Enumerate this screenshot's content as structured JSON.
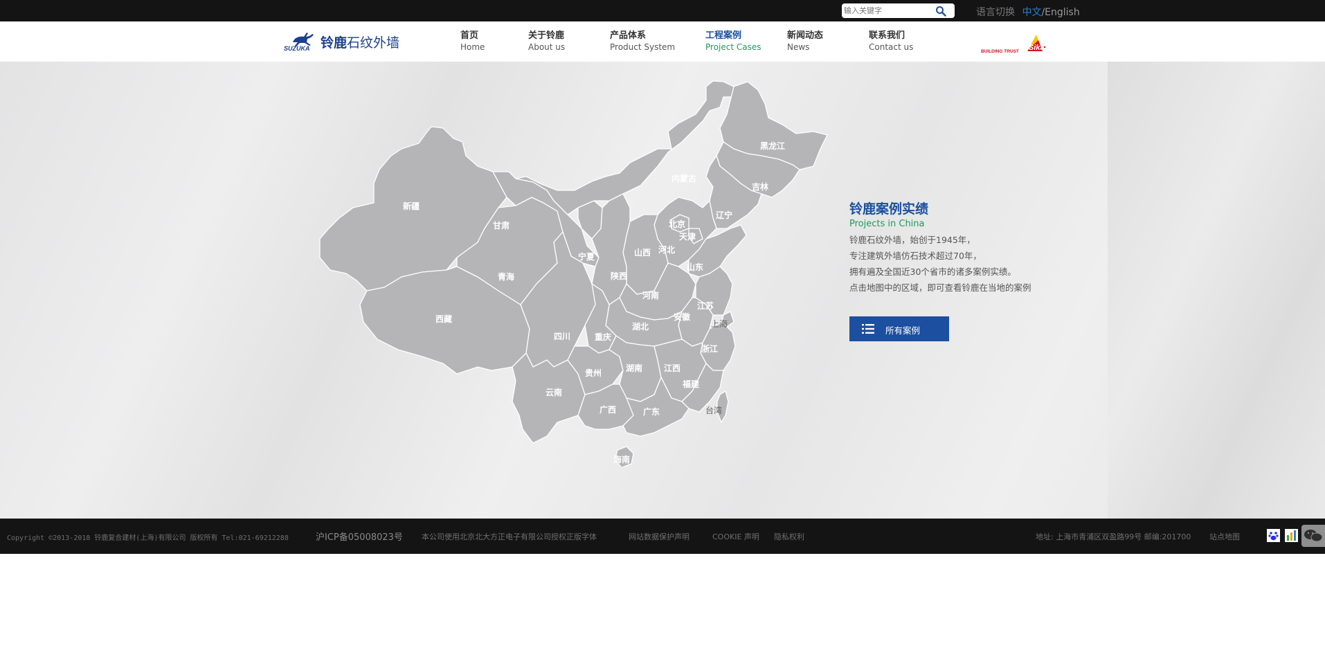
{
  "topbar": {
    "search_placeholder": "输入关键字",
    "lang_label": "语言切换",
    "lang_zh": "中文",
    "lang_sep": "/",
    "lang_en": "English"
  },
  "header": {
    "logo_text_bold": "铃鹿",
    "logo_text": "石纹外墙",
    "logo_mark_text": "SUZUKA",
    "nav": [
      {
        "cn": "首页",
        "en": "Home",
        "active": false
      },
      {
        "cn": "关于铃鹿",
        "en": "About us",
        "active": false
      },
      {
        "cn": "产品体系",
        "en": "Product System",
        "active": false
      },
      {
        "cn": "工程案例",
        "en": "Project Cases",
        "active": true
      },
      {
        "cn": "新闻动态",
        "en": "News",
        "active": false
      },
      {
        "cn": "联系我们",
        "en": "Contact us",
        "active": false
      }
    ],
    "partner_slogan": "BUILDING TRUST",
    "partner_name": "Sika"
  },
  "map": {
    "provinces": {
      "xinjiang": "新疆",
      "xizang": "西藏",
      "qinghai": "青海",
      "gansu": "甘肃",
      "neimenggu": "内蒙古",
      "heilongjiang": "黑龙江",
      "jilin": "吉林",
      "liaoning": "辽宁",
      "beijing": "北京",
      "tianjin": "天津",
      "hebei": "河北",
      "shanxi": "山西",
      "shandong": "山东",
      "ningxia": "宁夏",
      "shaanxi": "陕西",
      "henan": "河南",
      "jiangsu": "江苏",
      "anhui": "安徽",
      "shanghai": "上海",
      "hubei": "湖北",
      "sichuan": "四川",
      "chongqing": "重庆",
      "zhejiang": "浙江",
      "guizhou": "贵州",
      "hunan": "湖南",
      "jiangxi": "江西",
      "fujian": "福建",
      "yunnan": "云南",
      "guangxi": "广西",
      "guangdong": "广东",
      "taiwan": "台湾",
      "hainan": "海南"
    }
  },
  "info": {
    "title": "铃鹿案例实绩",
    "subtitle": "Projects in China",
    "lines": [
      "铃鹿石纹外墙，始创于1945年，",
      "专注建筑外墙仿石技术超过70年，",
      "拥有遍及全国近30个省市的诸多案例实绩。",
      "点击地图中的区域，即可查看铃鹿在当地的案例"
    ],
    "button_label": "所有案例"
  },
  "footer": {
    "copyright": "Copyright ©2013-2018 铃鹿复合建材(上海)有限公司 版权所有 Tel:021-69212288",
    "icp": "沪ICP备05008023号",
    "font_notice": "本公司使用北京北大方正电子有限公司授权正版字体",
    "data_protection": "网站数据保护声明",
    "cookie": "COOKIE 声明",
    "privacy": "隐私权利",
    "address": "地址: 上海市青浦区双盈路99号 邮编:201700",
    "sitemap": "站点地图"
  },
  "colors": {
    "brand_blue": "#1c4fa0",
    "accent_green": "#1e9a5a",
    "dark_bar": "#141414",
    "map_fill": "#b5b4b6"
  }
}
